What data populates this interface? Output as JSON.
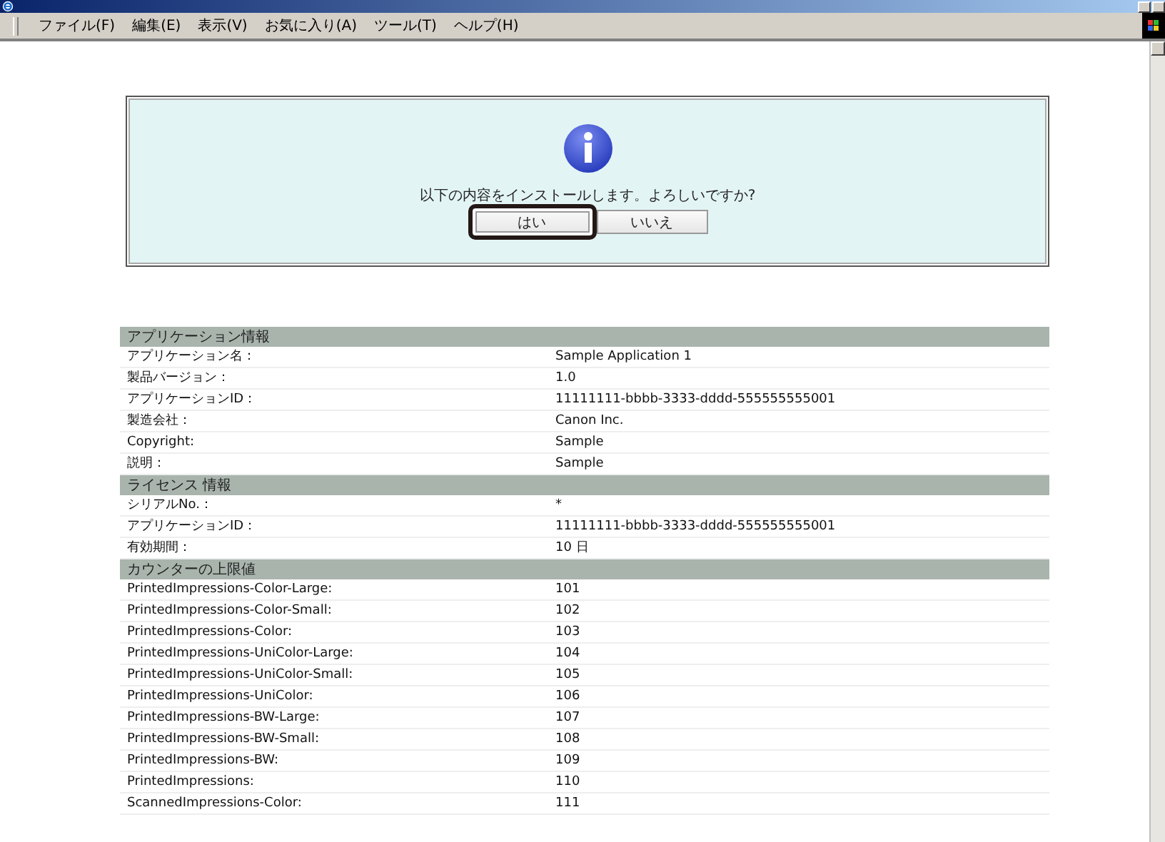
{
  "menu": [
    "ファイル(F)",
    "編集(E)",
    "表示(V)",
    "お気に入り(A)",
    "ツール(T)",
    "ヘルプ(H)"
  ],
  "dialog": {
    "message": "以下の内容をインストールします。よろしいですか?",
    "buttons": [
      {
        "label": "はい",
        "highlighted": true
      },
      {
        "label": "いいえ",
        "highlighted": false
      }
    ]
  },
  "sections": [
    {
      "title": "アプリケーション情報",
      "rows": [
        {
          "label": "アプリケーション名：",
          "value": "Sample Application 1"
        },
        {
          "label": "製品バージョン：",
          "value": "1.0"
        },
        {
          "label": "アプリケーションID：",
          "value": "11111111-bbbb-3333-dddd-555555555001"
        },
        {
          "label": "製造会社：",
          "value": "Canon Inc."
        },
        {
          "label": "Copyright:",
          "value": "Sample"
        },
        {
          "label": "説明：",
          "value": "Sample"
        }
      ]
    },
    {
      "title": "ライセンス 情報",
      "rows": [
        {
          "label": "シリアルNo.：",
          "value": "*"
        },
        {
          "label": "アプリケーションID：",
          "value": "11111111-bbbb-3333-dddd-555555555001"
        },
        {
          "label": "有効期間：",
          "value": "10 日"
        }
      ]
    },
    {
      "title": "カウンターの上限値",
      "rows": [
        {
          "label": "PrintedImpressions-Color-Large:",
          "value": "101"
        },
        {
          "label": "PrintedImpressions-Color-Small:",
          "value": "102"
        },
        {
          "label": "PrintedImpressions-Color:",
          "value": "103"
        },
        {
          "label": "PrintedImpressions-UniColor-Large:",
          "value": "104"
        },
        {
          "label": "PrintedImpressions-UniColor-Small:",
          "value": "105"
        },
        {
          "label": "PrintedImpressions-UniColor:",
          "value": "106"
        },
        {
          "label": "PrintedImpressions-BW-Large:",
          "value": "107"
        },
        {
          "label": "PrintedImpressions-BW-Small:",
          "value": "108"
        },
        {
          "label": "PrintedImpressions-BW:",
          "value": "109"
        },
        {
          "label": "PrintedImpressions:",
          "value": "110"
        },
        {
          "label": "ScannedImpressions-Color:",
          "value": "111"
        }
      ]
    }
  ]
}
